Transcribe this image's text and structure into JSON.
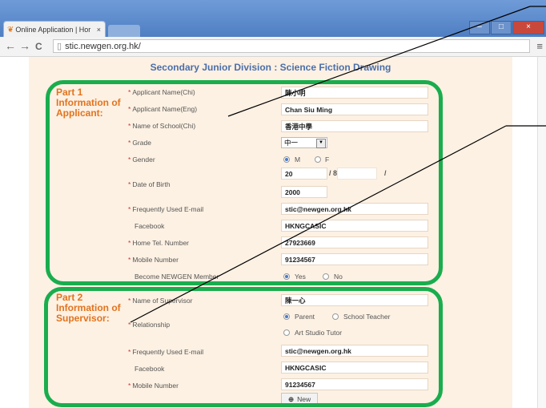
{
  "browser": {
    "tab_title": "Online Application | Hor",
    "tab_close": "×",
    "back": "←",
    "forward": "→",
    "reload": "C",
    "url": "stic.newgen.org.hk/",
    "menu": "≡",
    "win_min": "–",
    "win_max": "□",
    "win_close": "×"
  },
  "page_title": "Secondary Junior Division : Science Fiction Drawing",
  "part1": {
    "title_lines": [
      "Part 1",
      "Information of",
      "Applicant:"
    ],
    "applicant_name_chi": {
      "label": "Applicant Name(Chi)",
      "value": "陳小明"
    },
    "applicant_name_eng": {
      "label": "Applicant Name(Eng)",
      "value": "Chan Siu Ming"
    },
    "school_name_chi": {
      "label": "Name of School(Chi)",
      "value": "香港中學"
    },
    "grade": {
      "label": "Grade",
      "value": "中一"
    },
    "gender": {
      "label": "Gender",
      "opt_m": "M",
      "opt_f": "F",
      "selected": "M"
    },
    "dob": {
      "label": "Date of Birth",
      "day": "20",
      "sep1": "/ 8",
      "sep2": "/",
      "year": "2000"
    },
    "email": {
      "label": "Frequently Used E-mail",
      "value": "stic@newgen.org.hk"
    },
    "facebook": {
      "label": "Facebook",
      "value": "HKNGCASIC"
    },
    "home_tel": {
      "label": "Home Tel. Number",
      "value": "27923669"
    },
    "mobile": {
      "label": "Mobile Number",
      "value": "91234567"
    },
    "member": {
      "label": "Become NEWGEN Member",
      "opt_yes": "Yes",
      "opt_no": "No",
      "selected": "Yes"
    }
  },
  "part2": {
    "title_lines": [
      "Part 2",
      "Information of",
      "Supervisor:"
    ],
    "supervisor_name": {
      "label": "Name of Supervisor",
      "value": "陳一心"
    },
    "relationship": {
      "label": "Relationship",
      "opt_parent": "Parent",
      "opt_teacher": "School Teacher",
      "opt_tutor": "Art Studio Tutor",
      "selected": "Parent"
    },
    "email": {
      "label": "Frequently Used E-mail",
      "value": "stic@newgen.org.hk"
    },
    "facebook": {
      "label": "Facebook",
      "value": "HKNGCASIC"
    },
    "mobile": {
      "label": "Mobile Number",
      "value": "91234567"
    },
    "new_button": "New"
  },
  "required_mark": "*",
  "colors": {
    "accent_green": "#1aad4e",
    "section_orange": "#e2731e",
    "title_blue": "#4a6ea9",
    "page_bg": "#fdf1e3"
  }
}
